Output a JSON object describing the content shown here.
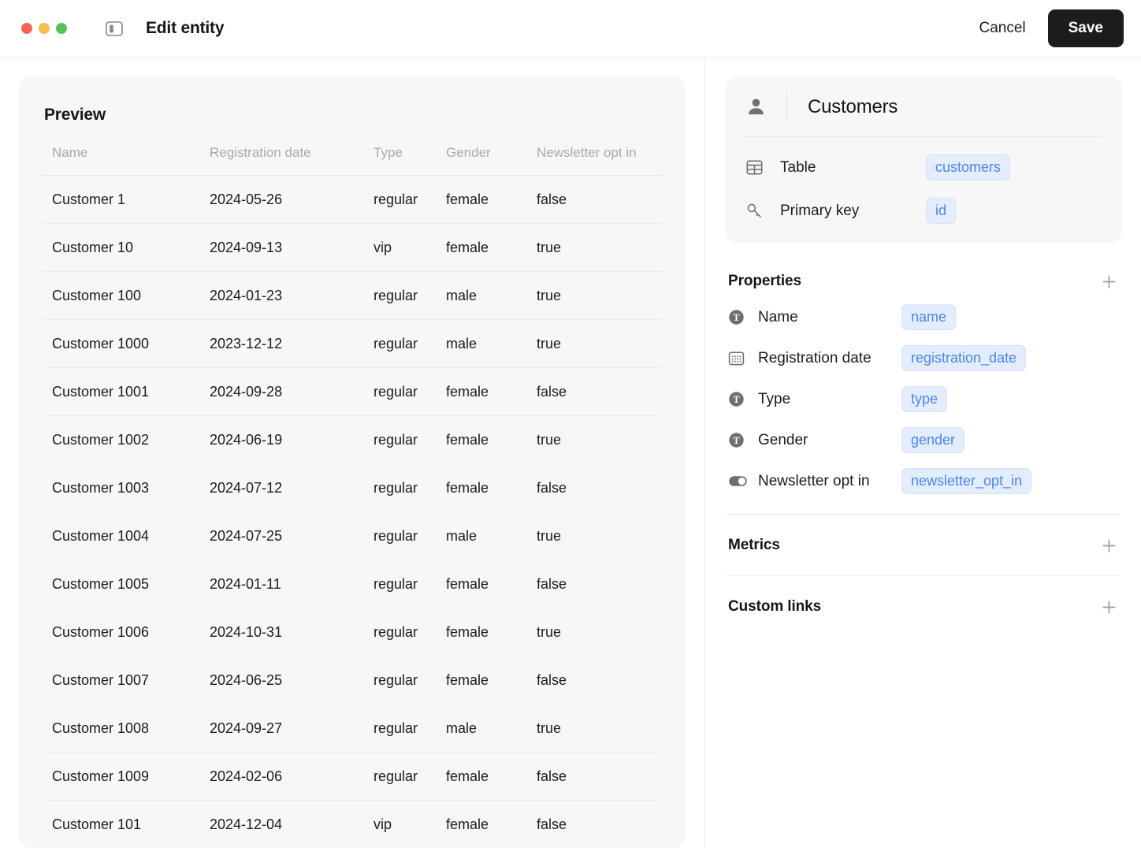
{
  "titlebar": {
    "traffic_lights": [
      "close",
      "minimize",
      "zoom"
    ],
    "sidebar_toggle_icon": "sidebar-toggle-icon",
    "title": "Edit entity",
    "cancel_label": "Cancel",
    "save_label": "Save"
  },
  "preview": {
    "heading": "Preview",
    "columns": [
      "Name",
      "Registration date",
      "Type",
      "Gender",
      "Newsletter opt in"
    ],
    "rows": [
      [
        "Customer 1",
        "2024-05-26",
        "regular",
        "female",
        "false"
      ],
      [
        "Customer 10",
        "2024-09-13",
        "vip",
        "female",
        "true"
      ],
      [
        "Customer 100",
        "2024-01-23",
        "regular",
        "male",
        "true"
      ],
      [
        "Customer 1000",
        "2023-12-12",
        "regular",
        "male",
        "true"
      ],
      [
        "Customer 1001",
        "2024-09-28",
        "regular",
        "female",
        "false"
      ],
      [
        "Customer 1002",
        "2024-06-19",
        "regular",
        "female",
        "true"
      ],
      [
        "Customer 1003",
        "2024-07-12",
        "regular",
        "female",
        "false"
      ],
      [
        "Customer 1004",
        "2024-07-25",
        "regular",
        "male",
        "true"
      ],
      [
        "Customer 1005",
        "2024-01-11",
        "regular",
        "female",
        "false"
      ],
      [
        "Customer 1006",
        "2024-10-31",
        "regular",
        "female",
        "true"
      ],
      [
        "Customer 1007",
        "2024-06-25",
        "regular",
        "female",
        "false"
      ],
      [
        "Customer 1008",
        "2024-09-27",
        "regular",
        "male",
        "true"
      ],
      [
        "Customer 1009",
        "2024-02-06",
        "regular",
        "female",
        "false"
      ],
      [
        "Customer 101",
        "2024-12-04",
        "vip",
        "female",
        "false"
      ]
    ]
  },
  "entity": {
    "icon": "person-icon",
    "name": "Customers",
    "fields": [
      {
        "icon": "table-grid-icon",
        "label": "Table",
        "value": "customers"
      },
      {
        "icon": "key-icon",
        "label": "Primary key",
        "value": "id"
      }
    ]
  },
  "properties": {
    "title": "Properties",
    "add_icon": "plus-icon",
    "items": [
      {
        "icon": "text-type-icon",
        "label": "Name",
        "value": "name"
      },
      {
        "icon": "calendar-icon",
        "label": "Registration date",
        "value": "registration_date"
      },
      {
        "icon": "text-type-icon",
        "label": "Type",
        "value": "type"
      },
      {
        "icon": "text-type-icon",
        "label": "Gender",
        "value": "gender"
      },
      {
        "icon": "boolean-toggle-icon",
        "label": "Newsletter opt in",
        "value": "newsletter_opt_in"
      }
    ]
  },
  "metrics": {
    "title": "Metrics",
    "add_icon": "plus-icon",
    "items": []
  },
  "custom_links": {
    "title": "Custom links",
    "add_icon": "plus-icon",
    "items": []
  },
  "colors": {
    "accent_chip_text": "#4a86ee",
    "accent_chip_bg": "#e4edfd",
    "save_button_bg": "#1c1c1e",
    "panel_bg": "#f7f7f7",
    "traffic_red": "#f2635a",
    "traffic_yellow": "#f4bd4f",
    "traffic_green": "#5ac05a"
  }
}
